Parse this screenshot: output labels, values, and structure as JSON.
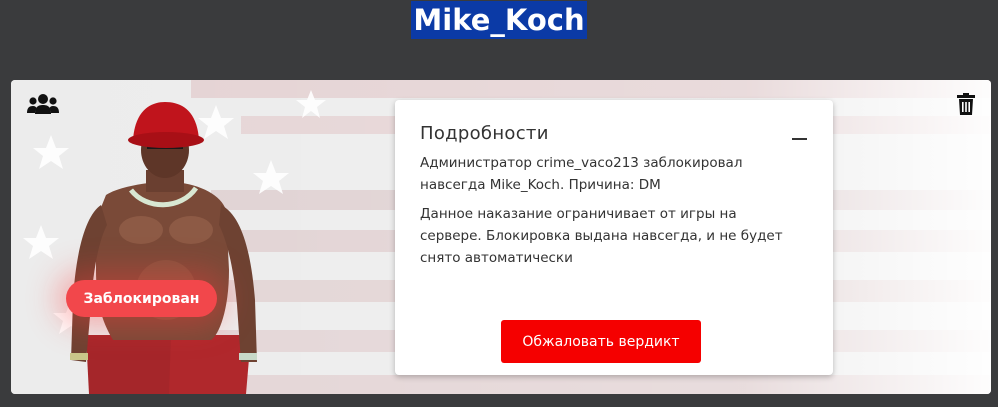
{
  "player": {
    "name": "Mike_Koch"
  },
  "status": {
    "badge_label": "Заблокирован",
    "badge_color": "#f2474b"
  },
  "details": {
    "title": "Подробности",
    "collapse_symbol": "—",
    "message": "Администратор crime_vaco213 заблокировал навсегда Mike_Koch. Причина: DM",
    "description": "Данное наказание ограничивает от игры на сервере. Блокировка выдана навсегда, и не будет снято автоматически",
    "appeal_button": "Обжаловать вердикт",
    "appeal_color": "#f50000"
  },
  "icons": {
    "left": "group-users-icon",
    "right": "trash-icon"
  },
  "colors": {
    "page_background": "#3a3b3d",
    "title_highlight": "#0b3aa6"
  }
}
